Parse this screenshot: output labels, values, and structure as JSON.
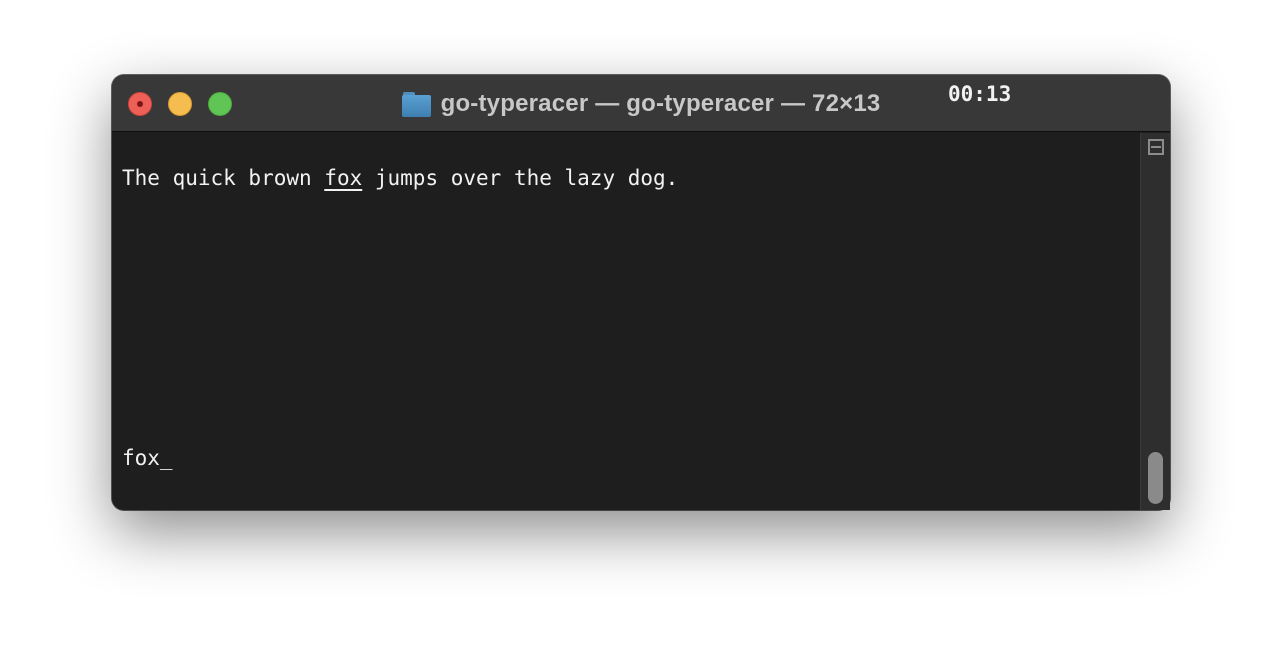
{
  "window": {
    "title": "go-typeracer — go-typeracer — 72×13",
    "title_icon": "folder-icon",
    "controls": {
      "close": "close-button",
      "minimize": "minimize-button",
      "zoom": "zoom-button"
    }
  },
  "terminal": {
    "timer": "00:13",
    "target_text": {
      "before": "The quick brown ",
      "current_word": "fox",
      "after": " jumps over the lazy dog."
    },
    "input_text": "fox_"
  },
  "colors": {
    "background": "#1e1e1e",
    "titlebar": "#383838",
    "text": "#f2f2f2",
    "close": "#ee5f57",
    "minimize": "#f5bd4f",
    "zoom": "#61c555"
  }
}
